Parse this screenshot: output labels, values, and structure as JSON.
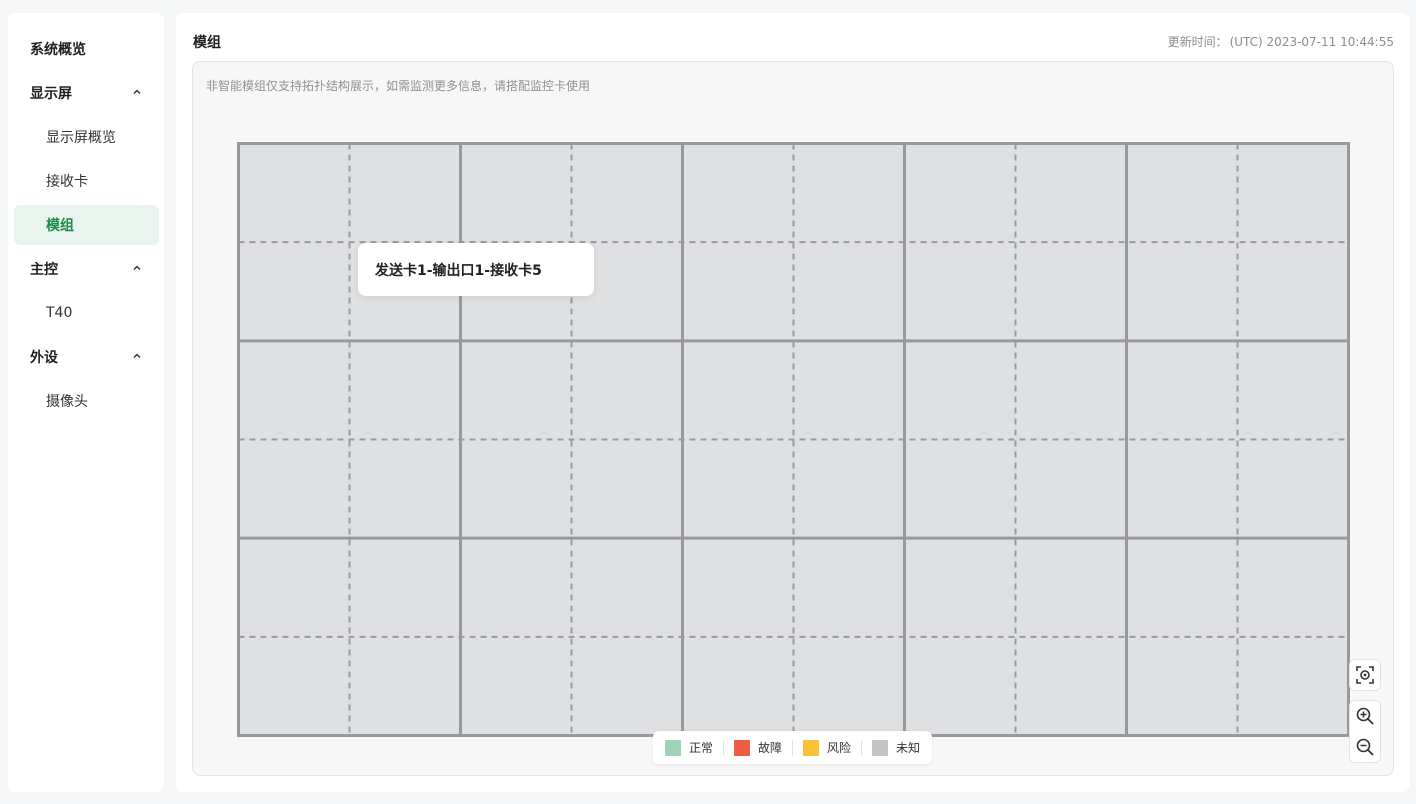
{
  "sidebar": {
    "overview": "系统概览",
    "groups": [
      {
        "title": "显示屏",
        "items": [
          "显示屏概览",
          "接收卡",
          "模组"
        ]
      },
      {
        "title": "主控",
        "items": [
          "T40"
        ]
      },
      {
        "title": "外设",
        "items": [
          "摄像头"
        ]
      }
    ],
    "active_item": "模组"
  },
  "header": {
    "title": "模组",
    "update_label": "更新时间：",
    "update_value": "(UTC) 2023-07-11 10:44:55"
  },
  "canvas": {
    "hint": "非智能模组仅支持拓扑结构展示，如需监测更多信息，请搭配监控卡使用",
    "grid": {
      "cabinet_columns": 5,
      "cabinet_rows": 3,
      "module_columns_per_cabinet": 2,
      "module_rows_per_cabinet": 2
    },
    "tooltip": "发送卡1-输出口1-接收卡5"
  },
  "legend": [
    {
      "label": "正常",
      "color": "#9fd3b6"
    },
    {
      "label": "故障",
      "color": "#f05d47"
    },
    {
      "label": "风险",
      "color": "#f7c234"
    },
    {
      "label": "未知",
      "color": "#c3c4c8"
    }
  ],
  "tools": {
    "locate_icon": "target-icon",
    "zoom_in_icon": "zoom-in-icon",
    "zoom_out_icon": "zoom-out-icon"
  }
}
